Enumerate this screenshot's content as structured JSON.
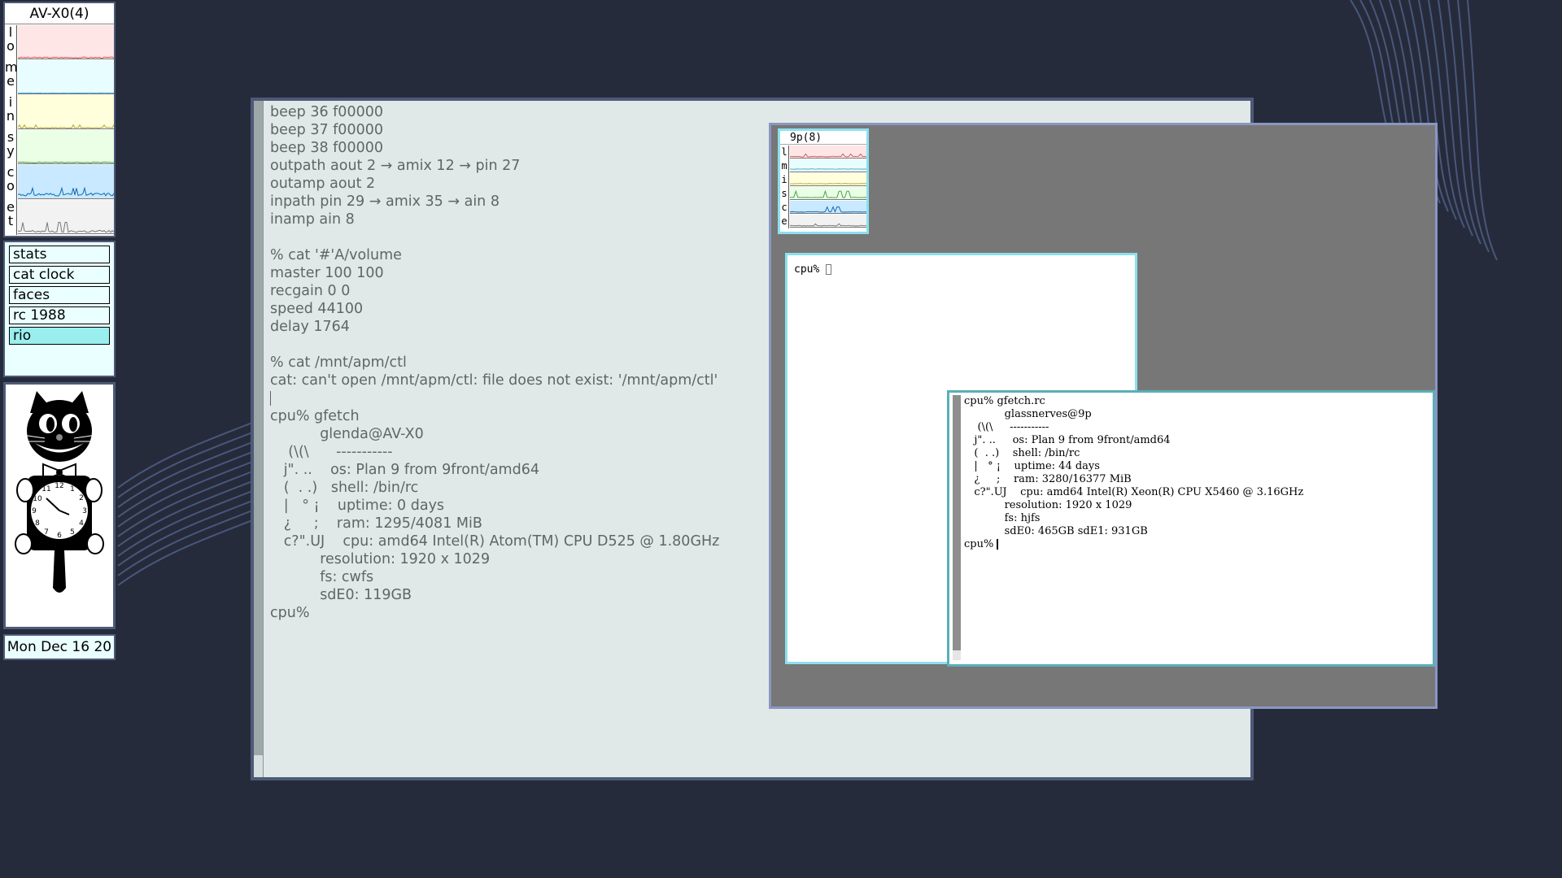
{
  "stats": {
    "title": "AV-X0(4)",
    "graphs": [
      {
        "letters": [
          "l",
          "o"
        ],
        "bg": "#ffe6e6",
        "line": "#d35a5a"
      },
      {
        "letters": [
          "m",
          "e"
        ],
        "bg": "#e8fdff",
        "line": "#4aa3c9"
      },
      {
        "letters": [
          "i",
          "n"
        ],
        "bg": "#ffffdc",
        "line": "#b2a640"
      },
      {
        "letters": [
          "s",
          "y"
        ],
        "bg": "#eaffe6",
        "line": "#3f9a43"
      },
      {
        "letters": [
          "c",
          "o"
        ],
        "bg": "#c8e9ff",
        "line": "#0c64b0"
      },
      {
        "letters": [
          "e",
          "t"
        ],
        "bg": "#f2f2f2",
        "line": "#777777"
      }
    ]
  },
  "launcher": {
    "items": [
      {
        "label": "stats",
        "active": false
      },
      {
        "label": "cat clock",
        "active": false
      },
      {
        "label": "faces",
        "active": false
      },
      {
        "label": "rc 1988",
        "active": false
      },
      {
        "label": "rio",
        "active": true
      }
    ]
  },
  "date": "Mon Dec 16 20",
  "terminal": {
    "lines": [
      "beep 36 f00000",
      "beep 37 f00000",
      "beep 38 f00000",
      "outpath aout 2 → amix 12 → pin 27",
      "outamp aout 2",
      "inpath pin 29 → amix 35 → ain 8",
      "inamp ain 8",
      "",
      "% cat '#'A/volume",
      "master 100 100",
      "recgain 0 0",
      "speed 44100",
      "delay 1764",
      "",
      "% cat /mnt/apm/ctl",
      "cat: can't open /mnt/apm/ctl: file does not exist: '/mnt/apm/ctl'",
      "",
      "cpu% gfetch",
      "           glenda@AV-X0",
      "    (\\(\\      -----------",
      "   j\". ..    os: Plan 9 from 9front/amd64",
      "   (  . .)   shell: /bin/rc",
      "   |   ° ¡    uptime: 0 days",
      "   ¿     ;    ram: 1295/4081 MiB",
      "   c?\".UJ    cpu: amd64 Intel(R) Atom(TM) CPU D525 @ 1.80GHz",
      "           resolution: 1920 x 1029",
      "           fs: cwfs",
      "           sdE0: 119GB",
      "cpu%"
    ]
  },
  "nested": {
    "stats_title": "9p(8)",
    "graphs": [
      {
        "letter": "l",
        "bg": "#ffe6e6",
        "line": "#d35a5a"
      },
      {
        "letter": "m",
        "bg": "#e8fdff",
        "line": "#4aa3c9"
      },
      {
        "letter": "i",
        "bg": "#ffffdc",
        "line": "#b2a640"
      },
      {
        "letter": "s",
        "bg": "#eaffe6",
        "line": "#3f9a43"
      },
      {
        "letter": "c",
        "bg": "#c8e9ff",
        "line": "#0c64b0"
      },
      {
        "letter": "e",
        "bg": "#f2f2f2",
        "line": "#777777"
      }
    ],
    "cpu_prompt": "cpu% ",
    "gfetch_lines": [
      "cpu% gfetch.rc",
      "            glassnerves@9p",
      "    (\\(\\     -----------",
      "   j\". ..     os: Plan 9 from 9front/amd64",
      "   (  . .)    shell: /bin/rc",
      "   |   ° ¡    uptime: 44 days",
      "   ¿     ;    ram: 3280/16377 MiB",
      "   c?\".UJ    cpu: amd64 Intel(R) Xeon(R) CPU X5460 @ 3.16GHz",
      "            resolution: 1920 x 1029",
      "            fs: hjfs",
      "            sdE0: 465GB sdE1: 931GB"
    ],
    "final_prompt": "cpu% "
  }
}
